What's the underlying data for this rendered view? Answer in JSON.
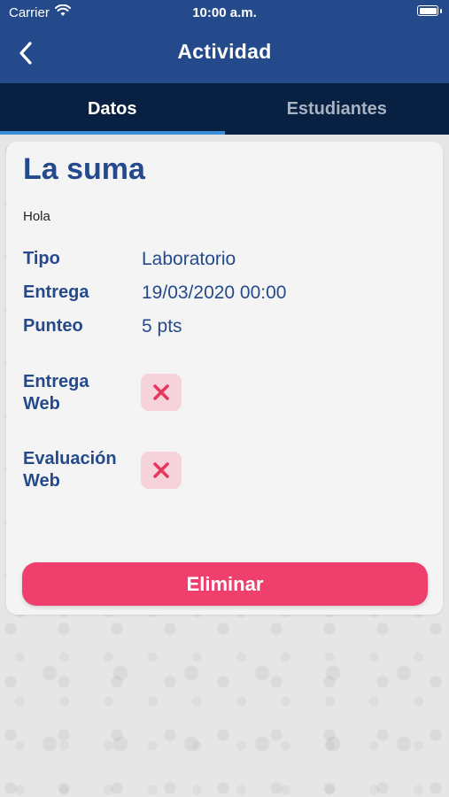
{
  "status_bar": {
    "carrier": "Carrier",
    "time": "10:00 a.m."
  },
  "nav": {
    "title": "Actividad",
    "back_icon": "chevron-left-icon"
  },
  "tabs": [
    {
      "label": "Datos",
      "active": true
    },
    {
      "label": "Estudiantes",
      "active": false
    }
  ],
  "activity": {
    "title": "La suma",
    "description": "Hola",
    "fields": [
      {
        "label": "Tipo",
        "value": "Laboratorio"
      },
      {
        "label": "Entrega",
        "value": "19/03/2020 00:00"
      },
      {
        "label": "Punteo",
        "value": "5 pts"
      }
    ],
    "flags": [
      {
        "label_line1": "Entrega",
        "label_line2": "Web",
        "enabled": false,
        "icon": "x-icon"
      },
      {
        "label_line1": "Evaluación",
        "label_line2": "Web",
        "enabled": false,
        "icon": "x-icon"
      }
    ],
    "delete_label": "Eliminar"
  },
  "colors": {
    "header": "#254a8c",
    "tab_bar": "#082143",
    "tab_indicator": "#3d8ed8",
    "danger": "#ef3f6d",
    "x_badge_bg": "#f6d2da",
    "x_icon": "#e6385f"
  }
}
